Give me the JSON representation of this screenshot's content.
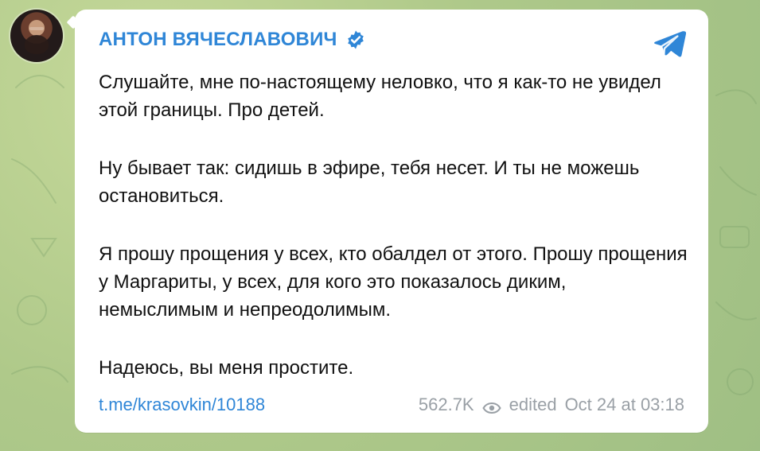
{
  "post": {
    "author": "АНТОН ВЯЧЕСЛАВОВИЧ",
    "paragraphs": [
      "Слушайте, мне по-настоящему неловко, что я как-то не увидел этой границы. Про детей.",
      "Ну бывает так: сидишь в эфире, тебя несет. И ты не можешь остановиться.",
      "Я прошу прощения у всех, кто обалдел от этого. Прошу прощения у Маргариты, у всех, для кого это показалось диким, немыслимым и непреодолимым.",
      "Надеюсь, вы меня простите."
    ],
    "link": "t.me/krasovkin/10188",
    "views": "562.7K",
    "edited": "edited",
    "timestamp": "Oct 24 at 03:18"
  },
  "icons": {
    "verified": "verified-badge-icon",
    "telegram": "telegram-plane-icon",
    "views": "eye-icon"
  },
  "colors": {
    "accent": "#2f86d7",
    "muted": "#9aa0a6",
    "background": "#afc98a",
    "bubble": "#ffffff"
  }
}
